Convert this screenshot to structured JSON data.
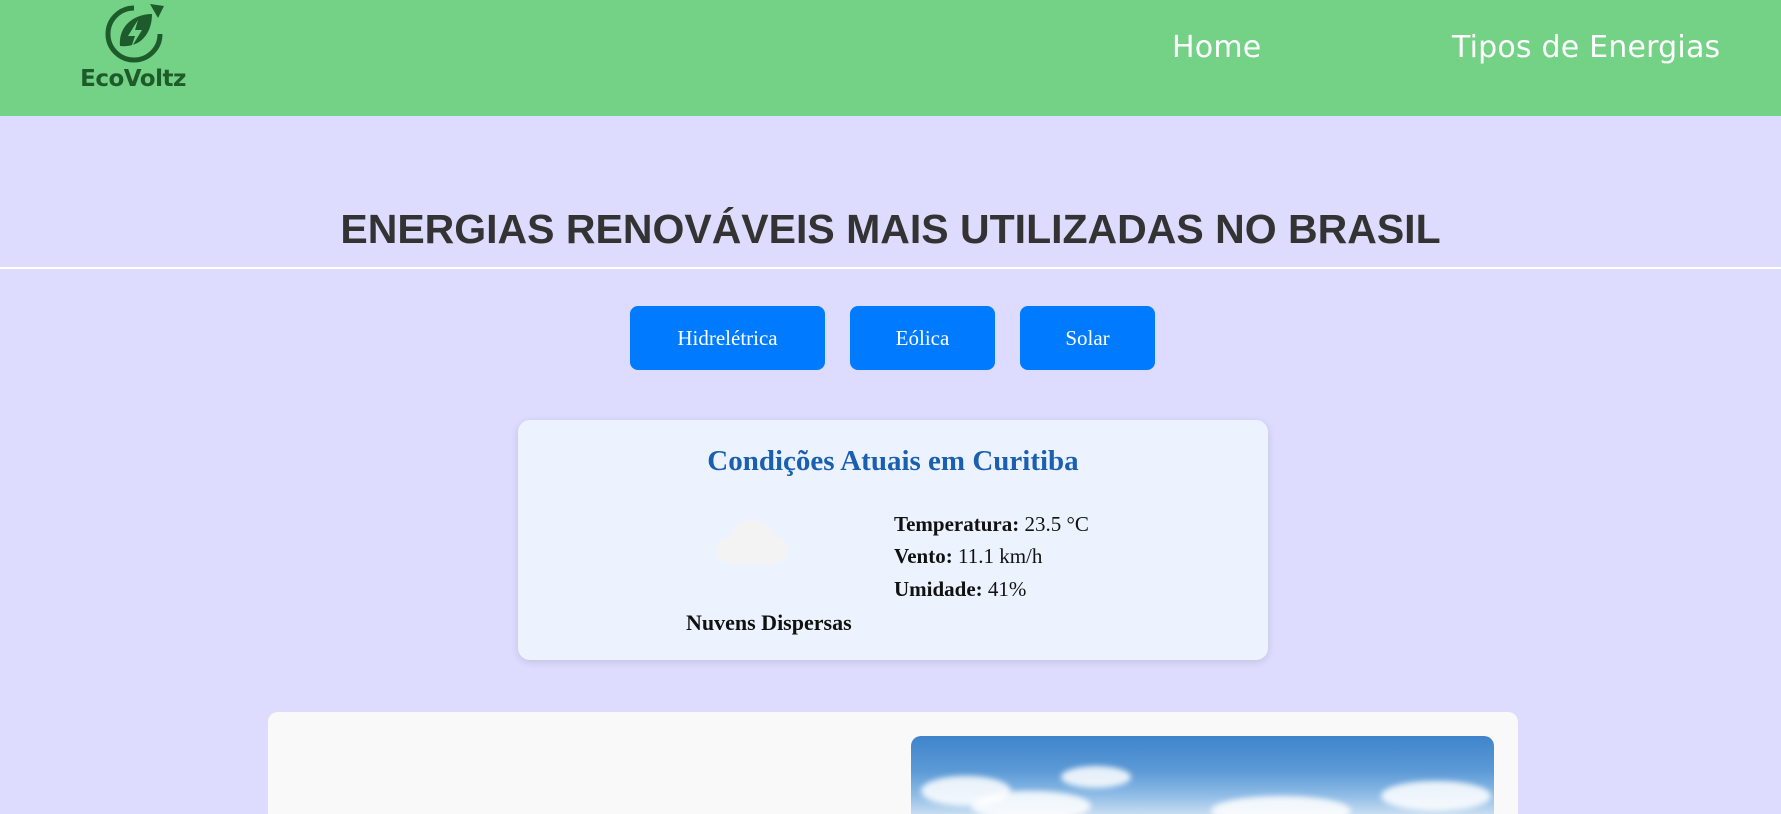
{
  "header": {
    "logo_text": "EcoVoltz",
    "nav": [
      {
        "label": "Home"
      },
      {
        "label": "Tipos de Energias"
      }
    ]
  },
  "main": {
    "title": "ENERGIAS RENOVÁVEIS MAIS UTILIZADAS NO BRASIL",
    "buttons": [
      {
        "label": "Hidrelétrica"
      },
      {
        "label": "Eólica"
      },
      {
        "label": "Solar"
      }
    ]
  },
  "weather": {
    "title": "Condições Atuais em Curitiba",
    "icon": "cloud-icon",
    "description": "Nuvens Dispersas",
    "temperature_label": "Temperatura:",
    "temperature_value": "23.5 °C",
    "wind_label": "Vento:",
    "wind_value": "11.1 km/h",
    "humidity_label": "Umidade:",
    "humidity_value": "41%"
  },
  "colors": {
    "header_bg": "#74d287",
    "page_bg": "#dddcfe",
    "button_bg": "#007bff",
    "weather_title": "#1a5fb0",
    "logo_green": "#1e5b2a"
  }
}
